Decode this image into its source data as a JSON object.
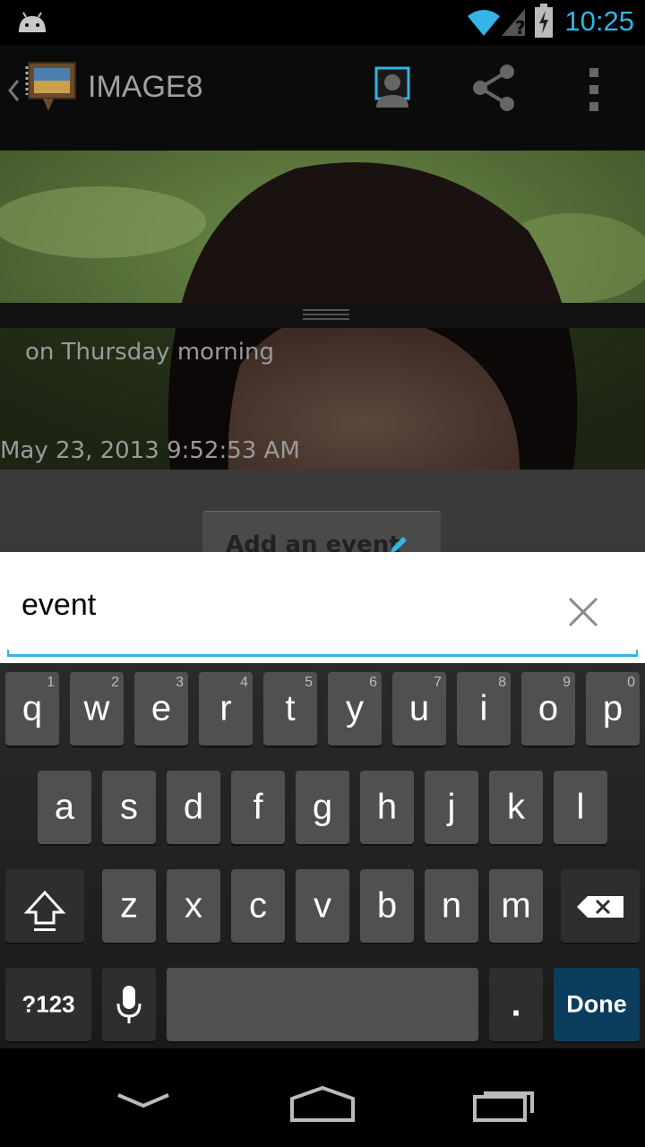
{
  "status_bar": {
    "time": "10:25",
    "icons": [
      "android-icon",
      "wifi-icon",
      "no-sim-icon",
      "battery-charging-icon"
    ]
  },
  "action_bar": {
    "title": "IMAGE8",
    "icons": [
      "back-chevron-icon",
      "app-logo-icon",
      "contact-icon",
      "share-icon",
      "overflow-menu-icon"
    ]
  },
  "photo": {
    "caption": "on Thursday morning",
    "timestamp": "May 23, 2013 9:52:53 AM"
  },
  "details": {
    "add_event_label": "Add an event",
    "icon": "pencil-icon"
  },
  "search": {
    "value": "event",
    "clear_icon": "close-icon"
  },
  "keyboard": {
    "row1": [
      {
        "k": "q",
        "n": "1"
      },
      {
        "k": "w",
        "n": "2"
      },
      {
        "k": "e",
        "n": "3"
      },
      {
        "k": "r",
        "n": "4"
      },
      {
        "k": "t",
        "n": "5"
      },
      {
        "k": "y",
        "n": "6"
      },
      {
        "k": "u",
        "n": "7"
      },
      {
        "k": "i",
        "n": "8"
      },
      {
        "k": "o",
        "n": "9"
      },
      {
        "k": "p",
        "n": "0"
      }
    ],
    "row2": [
      "a",
      "s",
      "d",
      "f",
      "g",
      "h",
      "j",
      "k",
      "l"
    ],
    "row3": [
      "z",
      "x",
      "c",
      "v",
      "b",
      "n",
      "m"
    ],
    "symbols_label": "?123",
    "period_label": ".",
    "done_label": "Done",
    "icons": [
      "shift-icon",
      "backspace-icon",
      "microphone-icon"
    ]
  },
  "nav_bar": {
    "icons": [
      "back-icon",
      "home-icon",
      "recent-apps-icon"
    ]
  },
  "colors": {
    "accent": "#33b5e5",
    "done_key": "#0b3e5c"
  }
}
